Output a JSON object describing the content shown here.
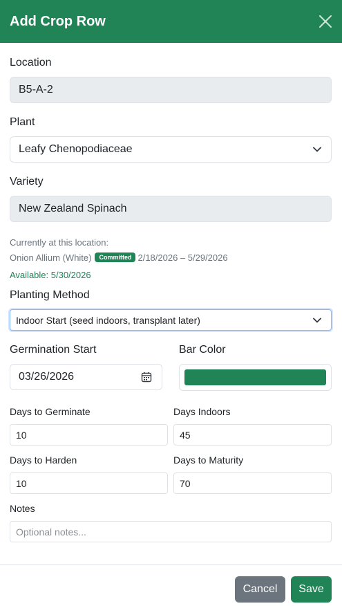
{
  "modal": {
    "title": "Add Crop Row"
  },
  "location": {
    "label": "Location",
    "value": "B5-A-2"
  },
  "plant": {
    "label": "Plant",
    "value": "Leafy Chenopodiaceae"
  },
  "variety": {
    "label": "Variety",
    "value": "New Zealand Spinach"
  },
  "current": {
    "heading": "Currently at this location:",
    "crop": "Onion Allium (White)",
    "badge": "Committed",
    "dates": "2/18/2026 – 5/29/2026",
    "available": "Available: 5/30/2026"
  },
  "planting_method": {
    "label": "Planting Method",
    "value": "Indoor Start (seed indoors, transplant later)"
  },
  "germination_start": {
    "label": "Germination Start",
    "value": "03/26/2026"
  },
  "bar_color": {
    "label": "Bar Color",
    "value": "#218456"
  },
  "days_to_germinate": {
    "label": "Days to Germinate",
    "value": "10"
  },
  "days_indoors": {
    "label": "Days Indoors",
    "value": "45"
  },
  "days_to_harden": {
    "label": "Days to Harden",
    "value": "10"
  },
  "days_to_maturity": {
    "label": "Days to Maturity",
    "value": "70"
  },
  "notes": {
    "label": "Notes",
    "placeholder": "Optional notes..."
  },
  "footer": {
    "cancel_label": "Cancel",
    "save_label": "Save"
  },
  "colors": {
    "primary": "#218456",
    "secondary": "#6c757d"
  },
  "icons": {
    "close": "close-icon",
    "dropdown": "chevron-down-icon",
    "calendar": "calendar-icon"
  }
}
